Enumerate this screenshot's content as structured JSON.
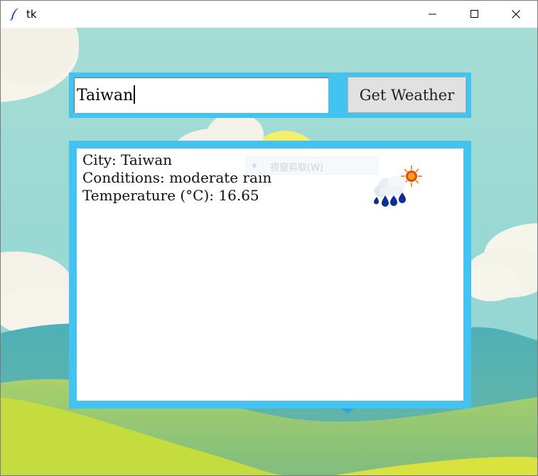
{
  "window": {
    "title": "tk",
    "controls": {
      "minimize": "minimize-icon",
      "maximize": "maximize-icon",
      "close": "close-icon"
    }
  },
  "search": {
    "value": "Taiwan",
    "button_label": "Get Weather"
  },
  "result": {
    "city_line": "City: Taiwan",
    "conditions_line": "Conditions: moderate rain",
    "temperature_line": "Temperature (°C): 16.65",
    "icon": "rain-sun-weather-icon"
  },
  "ime_tooltip": {
    "text": "視窗剪取(W)"
  },
  "colors": {
    "frame_accent": "#45c3f0",
    "sky": "#9fdcd2",
    "hills_green": "#7bbf7a",
    "hills_yellow": "#c4dc3e",
    "button_face": "#e1e1e1"
  }
}
